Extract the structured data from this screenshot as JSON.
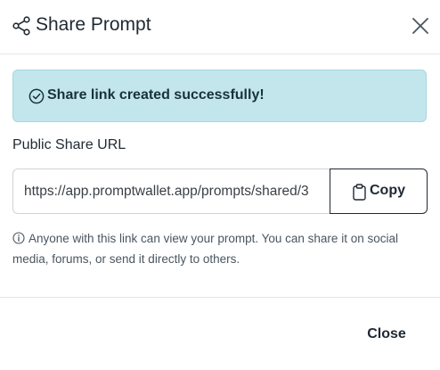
{
  "dialog": {
    "title": "Share Prompt",
    "icons": {
      "header": "share-icon",
      "close": "close-icon"
    }
  },
  "banner": {
    "message": "Share link created successfully!",
    "icon": "check-circle-icon",
    "colors": {
      "background": "#c3e6ec",
      "border": "#a6d6df",
      "text": "#17323b"
    }
  },
  "share_url": {
    "label": "Public Share URL",
    "value": "https://app.promptwallet.app/prompts/shared/3"
  },
  "copy_button": {
    "label": "Copy",
    "icon": "clipboard-icon"
  },
  "info": {
    "icon": "info-icon",
    "text": "Anyone with this link can view your prompt. You can share it on social media, forums, or send it directly to others."
  },
  "footer": {
    "close_label": "Close"
  }
}
